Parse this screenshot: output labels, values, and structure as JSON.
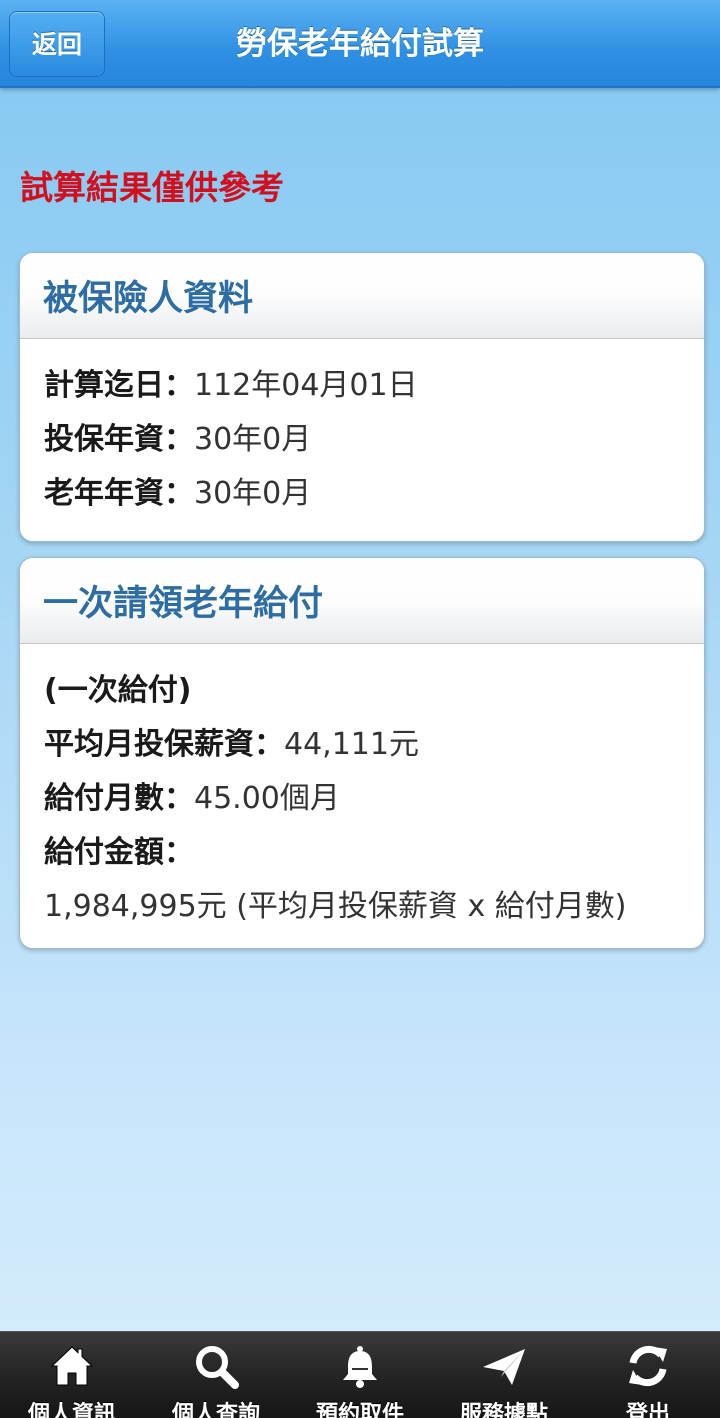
{
  "header": {
    "back_label": "返回",
    "title": "勞保老年給付試算"
  },
  "notice": "試算結果僅供參考",
  "insured_card": {
    "title": "被保險人資料",
    "rows": [
      {
        "label": "計算迄日：",
        "value": "112年04月01日"
      },
      {
        "label": "投保年資：",
        "value": "30年0月"
      },
      {
        "label": "老年年資：",
        "value": "30年0月"
      }
    ]
  },
  "lump_sum_card": {
    "title": "一次請領老年給付",
    "subtitle": "(一次給付)",
    "avg_salary_label": "平均月投保薪資：",
    "avg_salary_value": "44,111元",
    "months_label": "給付月數：",
    "months_value": "45.00個月",
    "amount_label": "給付金額：",
    "amount_value": "1,984,995元 (平均月投保薪資 x 給付月數)"
  },
  "tabbar": {
    "items": [
      {
        "icon": "home-icon",
        "label": "個人資訊"
      },
      {
        "icon": "search-icon",
        "label": "個人查詢"
      },
      {
        "icon": "bell-icon",
        "label": "預約取件"
      },
      {
        "icon": "paper-plane-icon",
        "label": "服務據點"
      },
      {
        "icon": "refresh-icon",
        "label": "登出"
      }
    ]
  },
  "colors": {
    "notice": "#d20f1e",
    "card_title": "#2d6da3",
    "header_blue": "#2f8fe3"
  }
}
